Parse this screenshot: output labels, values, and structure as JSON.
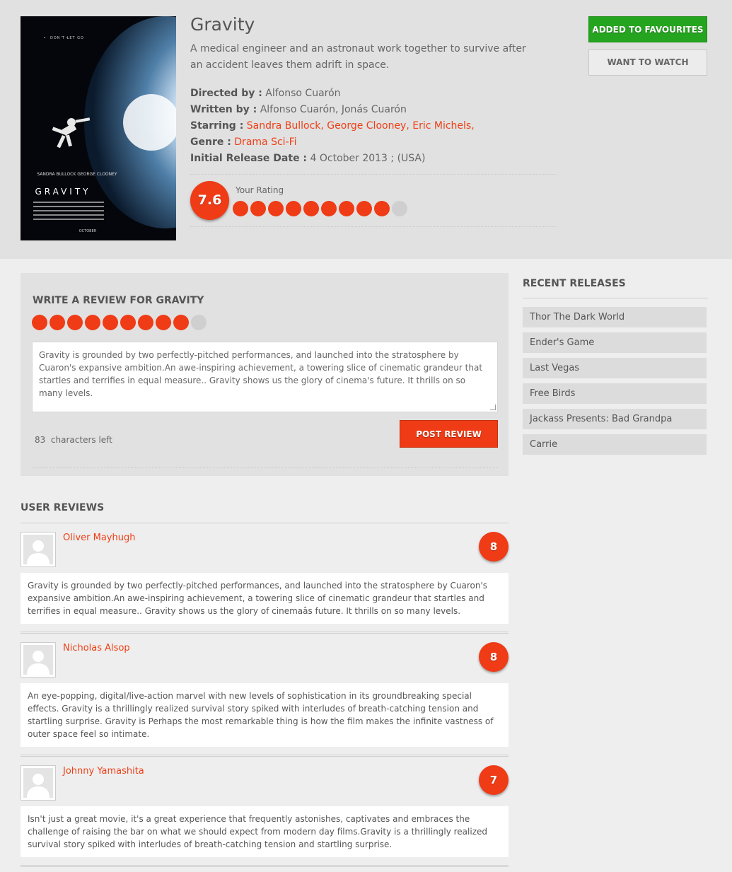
{
  "movie": {
    "title": "Gravity",
    "synopsis": "A medical engineer and an astronaut work together to survive after an accident leaves them adrift in space.",
    "directed_label": "Directed by :",
    "directed_value": "Alfonso Cuarón",
    "written_label": "Written by :",
    "written_value": "Alfonso Cuarón, Jonás Cuarón",
    "starring_label": "Starring :",
    "starring_value": "Sandra Bullock, George Clooney, Eric Michels,",
    "genre_label": "Genre :",
    "genre_value": "Drama Sci-Fi",
    "release_label": "Initial Release Date :",
    "release_value": "4 October 2013 ; (USA)",
    "score": "7.6",
    "your_rating_label": "Your Rating",
    "your_rating_filled": 9,
    "your_rating_total": 10
  },
  "poster": {
    "tagline": "DON'T LET GO",
    "cast": "SANDRA BULLOCK GEORGE CLOONEY",
    "title": "GRAVITY",
    "month": "OCTOBER"
  },
  "actions": {
    "favourite_label": "ADDED TO FAVOURITES",
    "watch_label": "WANT TO WATCH"
  },
  "write_review": {
    "heading": "WRITE A REVIEW FOR GRAVITY",
    "rating_filled": 9,
    "rating_total": 10,
    "text": "Gravity is grounded by two perfectly-pitched performances, and launched into the stratosphere by Cuaron's expansive ambition.An awe-inspiring achievement, a towering slice of cinematic grandeur that startles and terrifies in equal measure.. Gravity shows us the glory of cinema's future. It thrills on so many levels.",
    "chars_count": "83",
    "chars_label": "characters left",
    "post_label": "POST REVIEW"
  },
  "sidebar": {
    "heading": "RECENT RELEASES",
    "items": [
      "Thor The Dark World",
      "Ender's Game",
      "Last Vegas",
      "Free Birds",
      "Jackass Presents: Bad Grandpa",
      "Carrie"
    ]
  },
  "user_reviews": {
    "heading": "USER REVIEWS",
    "items": [
      {
        "name": "Oliver Mayhugh",
        "score": "8",
        "text": "Gravity is grounded by two perfectly-pitched performances, and launched into the stratosphere by Cuaron's expansive ambition.An awe-inspiring achievement, a towering slice of cinematic grandeur that startles and terrifies in equal measure.. Gravity shows us the glory of cinemaâs future. It thrills on so many levels."
      },
      {
        "name": "Nicholas Alsop",
        "score": "8",
        "text": "An eye-popping, digital/live-action marvel with new levels of sophistication in its groundbreaking special effects. Gravity is a thrillingly realized survival story spiked with interludes of breath-catching tension and startling surprise. Gravity is Perhaps the most remarkable thing is how the film makes the infinite vastness of outer space feel so intimate."
      },
      {
        "name": "Johnny Yamashita",
        "score": "7",
        "text": "Isn't just a great movie, it's a great experience that frequently astonishes, captivates and embraces the challenge of raising the bar on what we should expect from modern day films.Gravity is a thrillingly realized survival story spiked with interludes of breath-catching tension and startling surprise."
      }
    ]
  }
}
